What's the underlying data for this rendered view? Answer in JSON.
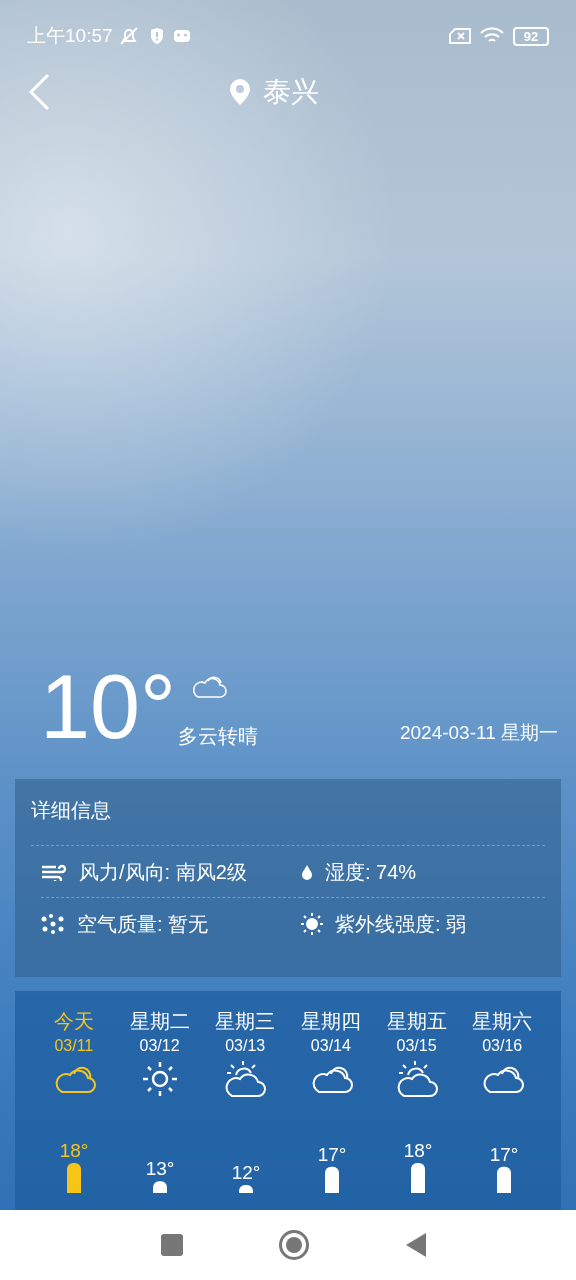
{
  "status_bar": {
    "time": "上午10:57",
    "battery": "92"
  },
  "header": {
    "city": "泰兴"
  },
  "current": {
    "temperature": "10°",
    "condition": "多云转晴",
    "date": "2024-03-11 星期一"
  },
  "details": {
    "title": "详细信息",
    "items": [
      {
        "kind": "wind",
        "text": "风力/风向: 南风2级"
      },
      {
        "kind": "humidity",
        "text": "湿度: 74%"
      },
      {
        "kind": "air",
        "text": "空气质量: 暂无"
      },
      {
        "kind": "uv",
        "text": "紫外线强度: 弱"
      }
    ]
  },
  "forecast": {
    "days": [
      {
        "day": "今天",
        "date": "03/11",
        "kind": "cloudy",
        "high": "18°",
        "selected": true
      },
      {
        "day": "星期二",
        "date": "03/12",
        "kind": "sunny",
        "high": "13°",
        "selected": false
      },
      {
        "day": "星期三",
        "date": "03/13",
        "kind": "partly_cloudy",
        "high": "12°",
        "selected": false
      },
      {
        "day": "星期四",
        "date": "03/14",
        "kind": "cloudy",
        "high": "17°",
        "selected": false
      },
      {
        "day": "星期五",
        "date": "03/15",
        "kind": "partly_cloudy",
        "high": "18°",
        "selected": false
      },
      {
        "day": "星期六",
        "date": "03/16",
        "kind": "cloudy",
        "high": "17°",
        "selected": false
      }
    ]
  }
}
